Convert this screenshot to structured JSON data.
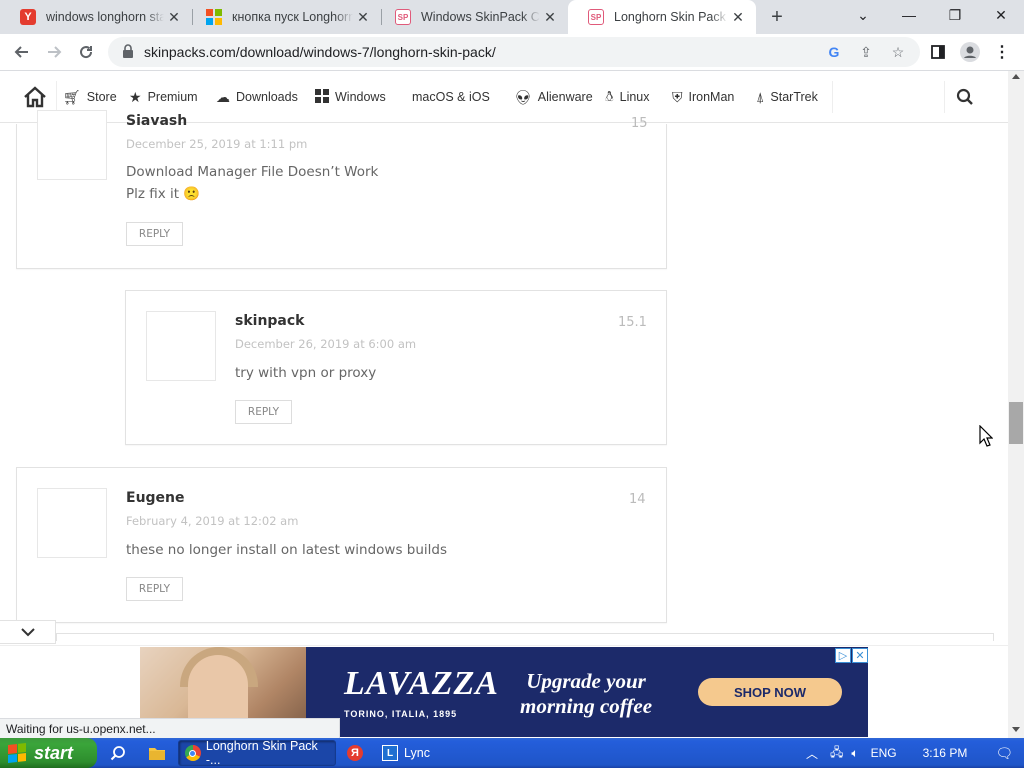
{
  "browser": {
    "tabs": [
      {
        "title": "windows longhorn start",
        "favicon": "yandex-icon",
        "color": "#e43c2f",
        "glyph": "Y"
      },
      {
        "title": "кнопка пуск Longhorn",
        "favicon": "windows-flag-icon",
        "color": "#3c7fd6",
        "glyph": ""
      },
      {
        "title": "Windows SkinPack Collection",
        "favicon": "skinpack-icon",
        "color": "#e05a7a",
        "glyph": "SP"
      },
      {
        "title": "Longhorn Skin Pack - SkinPack",
        "favicon": "skinpack-icon",
        "color": "#e05a7a",
        "glyph": "SP"
      }
    ],
    "active_tab": 3,
    "url": "skinpacks.com/download/windows-7/longhorn-skin-pack/"
  },
  "site_nav": {
    "items": [
      {
        "label": "Store",
        "icon": "cart-icon"
      },
      {
        "label": "Premium",
        "icon": "star-icon"
      },
      {
        "label": "Downloads",
        "icon": "cloud-download-icon"
      },
      {
        "label": "Windows",
        "icon": "windows-icon"
      },
      {
        "label": "macOS & iOS",
        "icon": "apple-icon"
      },
      {
        "label": "Alienware",
        "icon": "alien-icon"
      },
      {
        "label": "Linux",
        "icon": "linux-icon"
      },
      {
        "label": "IronMan",
        "icon": "ironman-icon"
      },
      {
        "label": "StarTrek",
        "icon": "startrek-icon"
      }
    ]
  },
  "comments": [
    {
      "author": "Siavash",
      "date": "December 25, 2019 at 1:11 pm",
      "text_lines": [
        "Download Manager File Doesn’t Work",
        "Plz fix it 🙁"
      ],
      "vote": "15",
      "reply": "REPLY"
    },
    {
      "author": "skinpack",
      "date": "December 26, 2019 at 6:00 am",
      "text_lines": [
        "try with vpn or proxy"
      ],
      "vote": "15.1",
      "reply": "REPLY"
    },
    {
      "author": "Eugene",
      "date": "February 4, 2019 at 12:02 am",
      "text_lines": [
        "these no longer install on latest windows builds"
      ],
      "vote": "14",
      "reply": "REPLY"
    }
  ],
  "ad": {
    "brand": "LAVAZZA",
    "brand_sub": "TORINO, ITALIA, 1895",
    "tagline_1": "Upgrade your",
    "tagline_2": "morning coffee",
    "cta": "SHOP NOW"
  },
  "status_text": "Waiting for us-u.openx.net...",
  "taskbar": {
    "start_label": "start",
    "tasks": [
      {
        "label": "Longhorn Skin Pack -...",
        "icon": "chrome-icon"
      },
      {
        "label": "",
        "icon": "yandex-icon"
      },
      {
        "label": "Lync",
        "icon": "lync-icon"
      }
    ],
    "lang": "ENG",
    "time": "3:16 PM"
  }
}
